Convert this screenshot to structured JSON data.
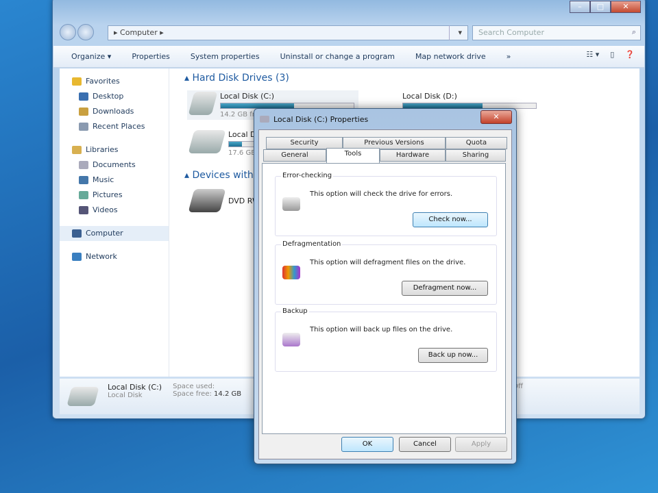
{
  "explorer": {
    "address": "Computer",
    "search_placeholder": "Search Computer",
    "toolbar": [
      "Organize ▾",
      "Properties",
      "System properties",
      "Uninstall or change a program",
      "Map network drive",
      "»"
    ],
    "nav": [
      {
        "label": "Favorites",
        "sub": false,
        "color": "#e8b830"
      },
      {
        "label": "Desktop",
        "sub": true,
        "color": "#3a6fb0"
      },
      {
        "label": "Downloads",
        "sub": true,
        "color": "#c9a040"
      },
      {
        "label": "Recent Places",
        "sub": true,
        "color": "#8a9ab0"
      },
      {
        "label": "",
        "sub": false,
        "color": ""
      },
      {
        "label": "Libraries",
        "sub": false,
        "color": "#d8b050"
      },
      {
        "label": "Documents",
        "sub": true,
        "color": "#aab"
      },
      {
        "label": "Music",
        "sub": true,
        "color": "#47a"
      },
      {
        "label": "Pictures",
        "sub": true,
        "color": "#6a9"
      },
      {
        "label": "Videos",
        "sub": true,
        "color": "#557"
      },
      {
        "label": "",
        "sub": false,
        "color": ""
      },
      {
        "label": "Computer",
        "sub": false,
        "color": "#3a5f90",
        "selected": true
      },
      {
        "label": "",
        "sub": false,
        "color": ""
      },
      {
        "label": "Network",
        "sub": false,
        "color": "#3a7fc0"
      }
    ],
    "group1": "Hard Disk Drives (3)",
    "group2": "Devices with Removable Storage",
    "drives": [
      {
        "name": "Local Disk (C:)",
        "free": "14.2 GB free",
        "used": 0.55
      },
      {
        "name": "Local Disk (D:)",
        "free": "",
        "used": 0.6
      },
      {
        "name": "Local Disk (E:)",
        "free": "17.6 GB free",
        "used": 0.1
      }
    ],
    "dvd": "DVD RW Drive",
    "details": {
      "name": "Local Disk (C:)",
      "type": "Local Disk",
      "used_label": "Space used:",
      "free_label": "Space free:",
      "free": "14.2 GB",
      "extra": "Off"
    }
  },
  "dialog": {
    "title": "Local Disk (C:) Properties",
    "tabs_top": [
      "Security",
      "Previous Versions",
      "Quota"
    ],
    "tabs_bottom": [
      "General",
      "Tools",
      "Hardware",
      "Sharing"
    ],
    "groups": [
      {
        "legend": "Error-checking",
        "text": "This option will check the drive for errors.",
        "button": "Check now..."
      },
      {
        "legend": "Defragmentation",
        "text": "This option will defragment files on the drive.",
        "button": "Defragment now..."
      },
      {
        "legend": "Backup",
        "text": "This option will back up files on the drive.",
        "button": "Back up now..."
      }
    ],
    "ok": "OK",
    "cancel": "Cancel",
    "apply": "Apply"
  }
}
